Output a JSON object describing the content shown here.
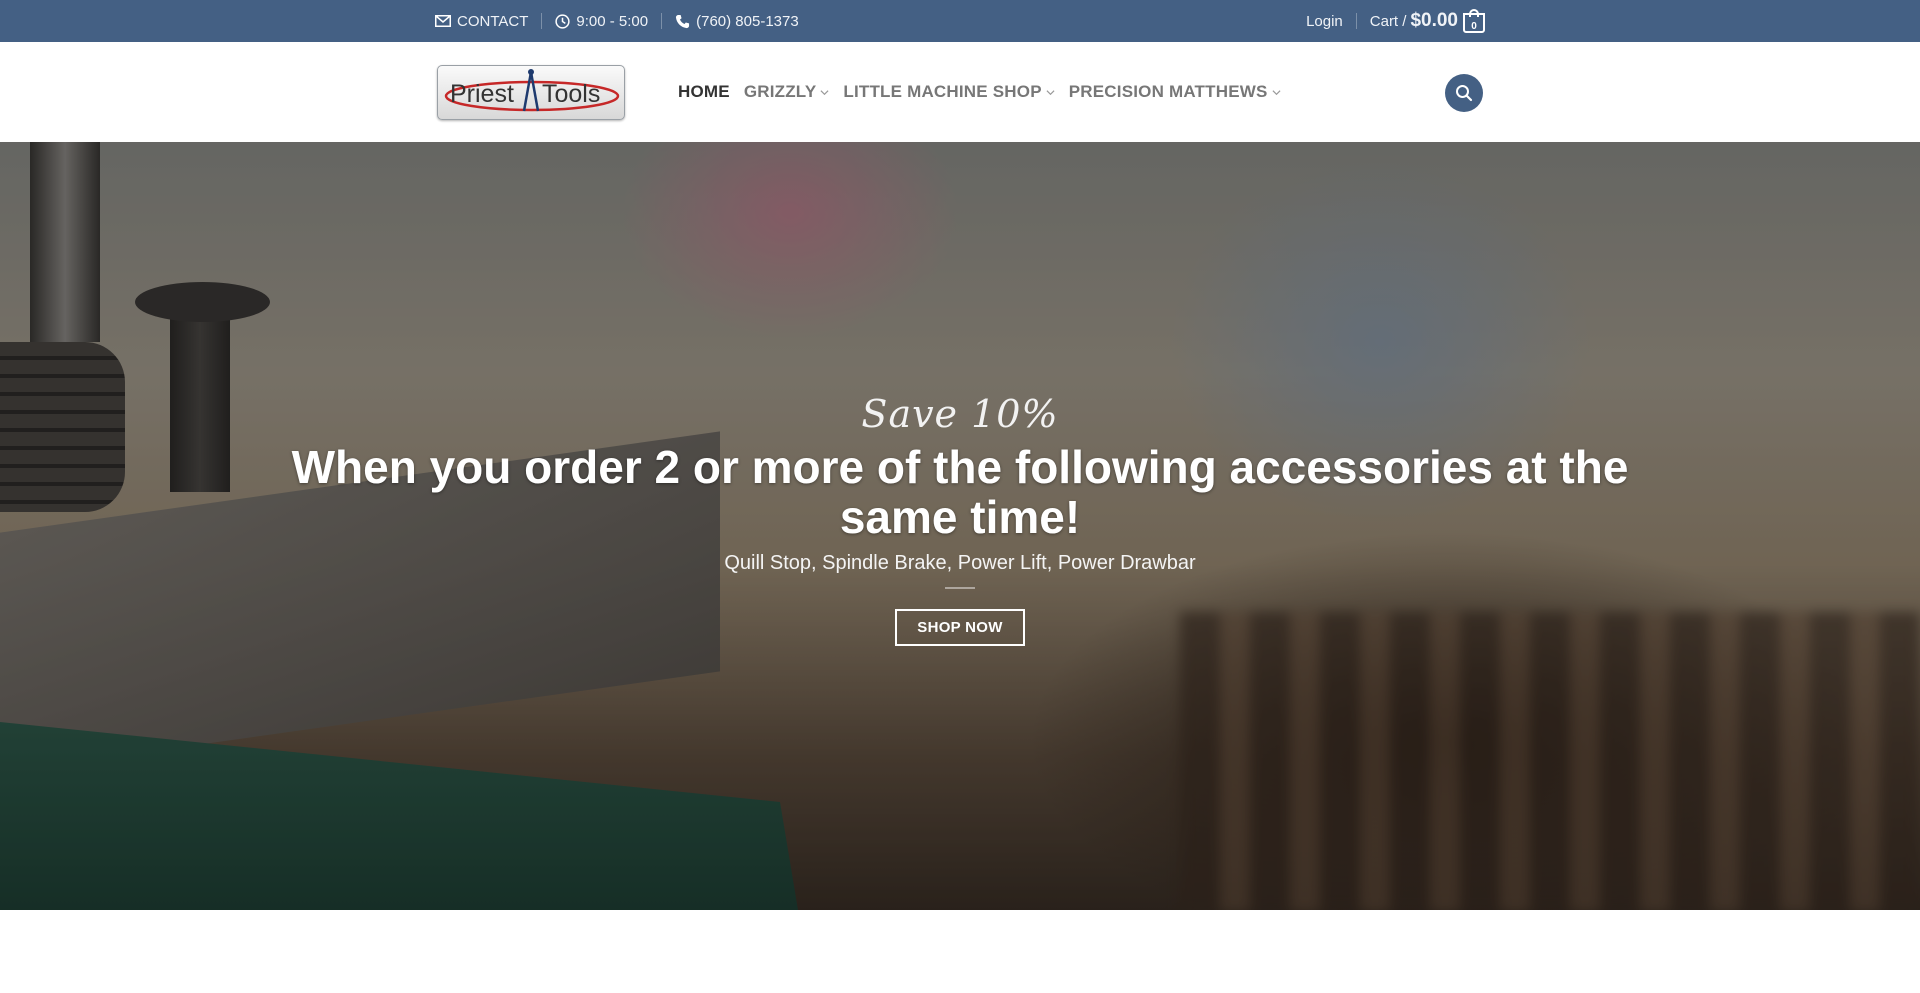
{
  "topbar": {
    "contact_label": "CONTACT",
    "hours": "9:00 - 5:00",
    "phone": "(760) 805-1373",
    "login_label": "Login",
    "cart_label": "Cart /",
    "cart_amount": "$0.00",
    "cart_count": "0",
    "icons": {
      "contact": "envelope-icon",
      "hours": "clock-icon",
      "phone": "phone-icon",
      "cart": "shopping-bag-icon"
    }
  },
  "header": {
    "logo_text": "Priest Tools",
    "nav": [
      {
        "label": "HOME",
        "active": true,
        "has_dropdown": false
      },
      {
        "label": "GRIZZLY",
        "active": false,
        "has_dropdown": true
      },
      {
        "label": "LITTLE MACHINE SHOP",
        "active": false,
        "has_dropdown": true
      },
      {
        "label": "PRECISION MATTHEWS",
        "active": false,
        "has_dropdown": true
      }
    ],
    "search_icon": "search-icon"
  },
  "hero": {
    "script_text": "Save 10%",
    "headline": "When you order 2 or more of the following accessories at the same time!",
    "subtext": "Quill Stop, Spindle Brake, Power Lift, Power Drawbar",
    "button_label": "SHOP NOW"
  },
  "colors": {
    "primary": "#446084",
    "nav_active": "#333333",
    "nav_inactive": "#777777"
  }
}
